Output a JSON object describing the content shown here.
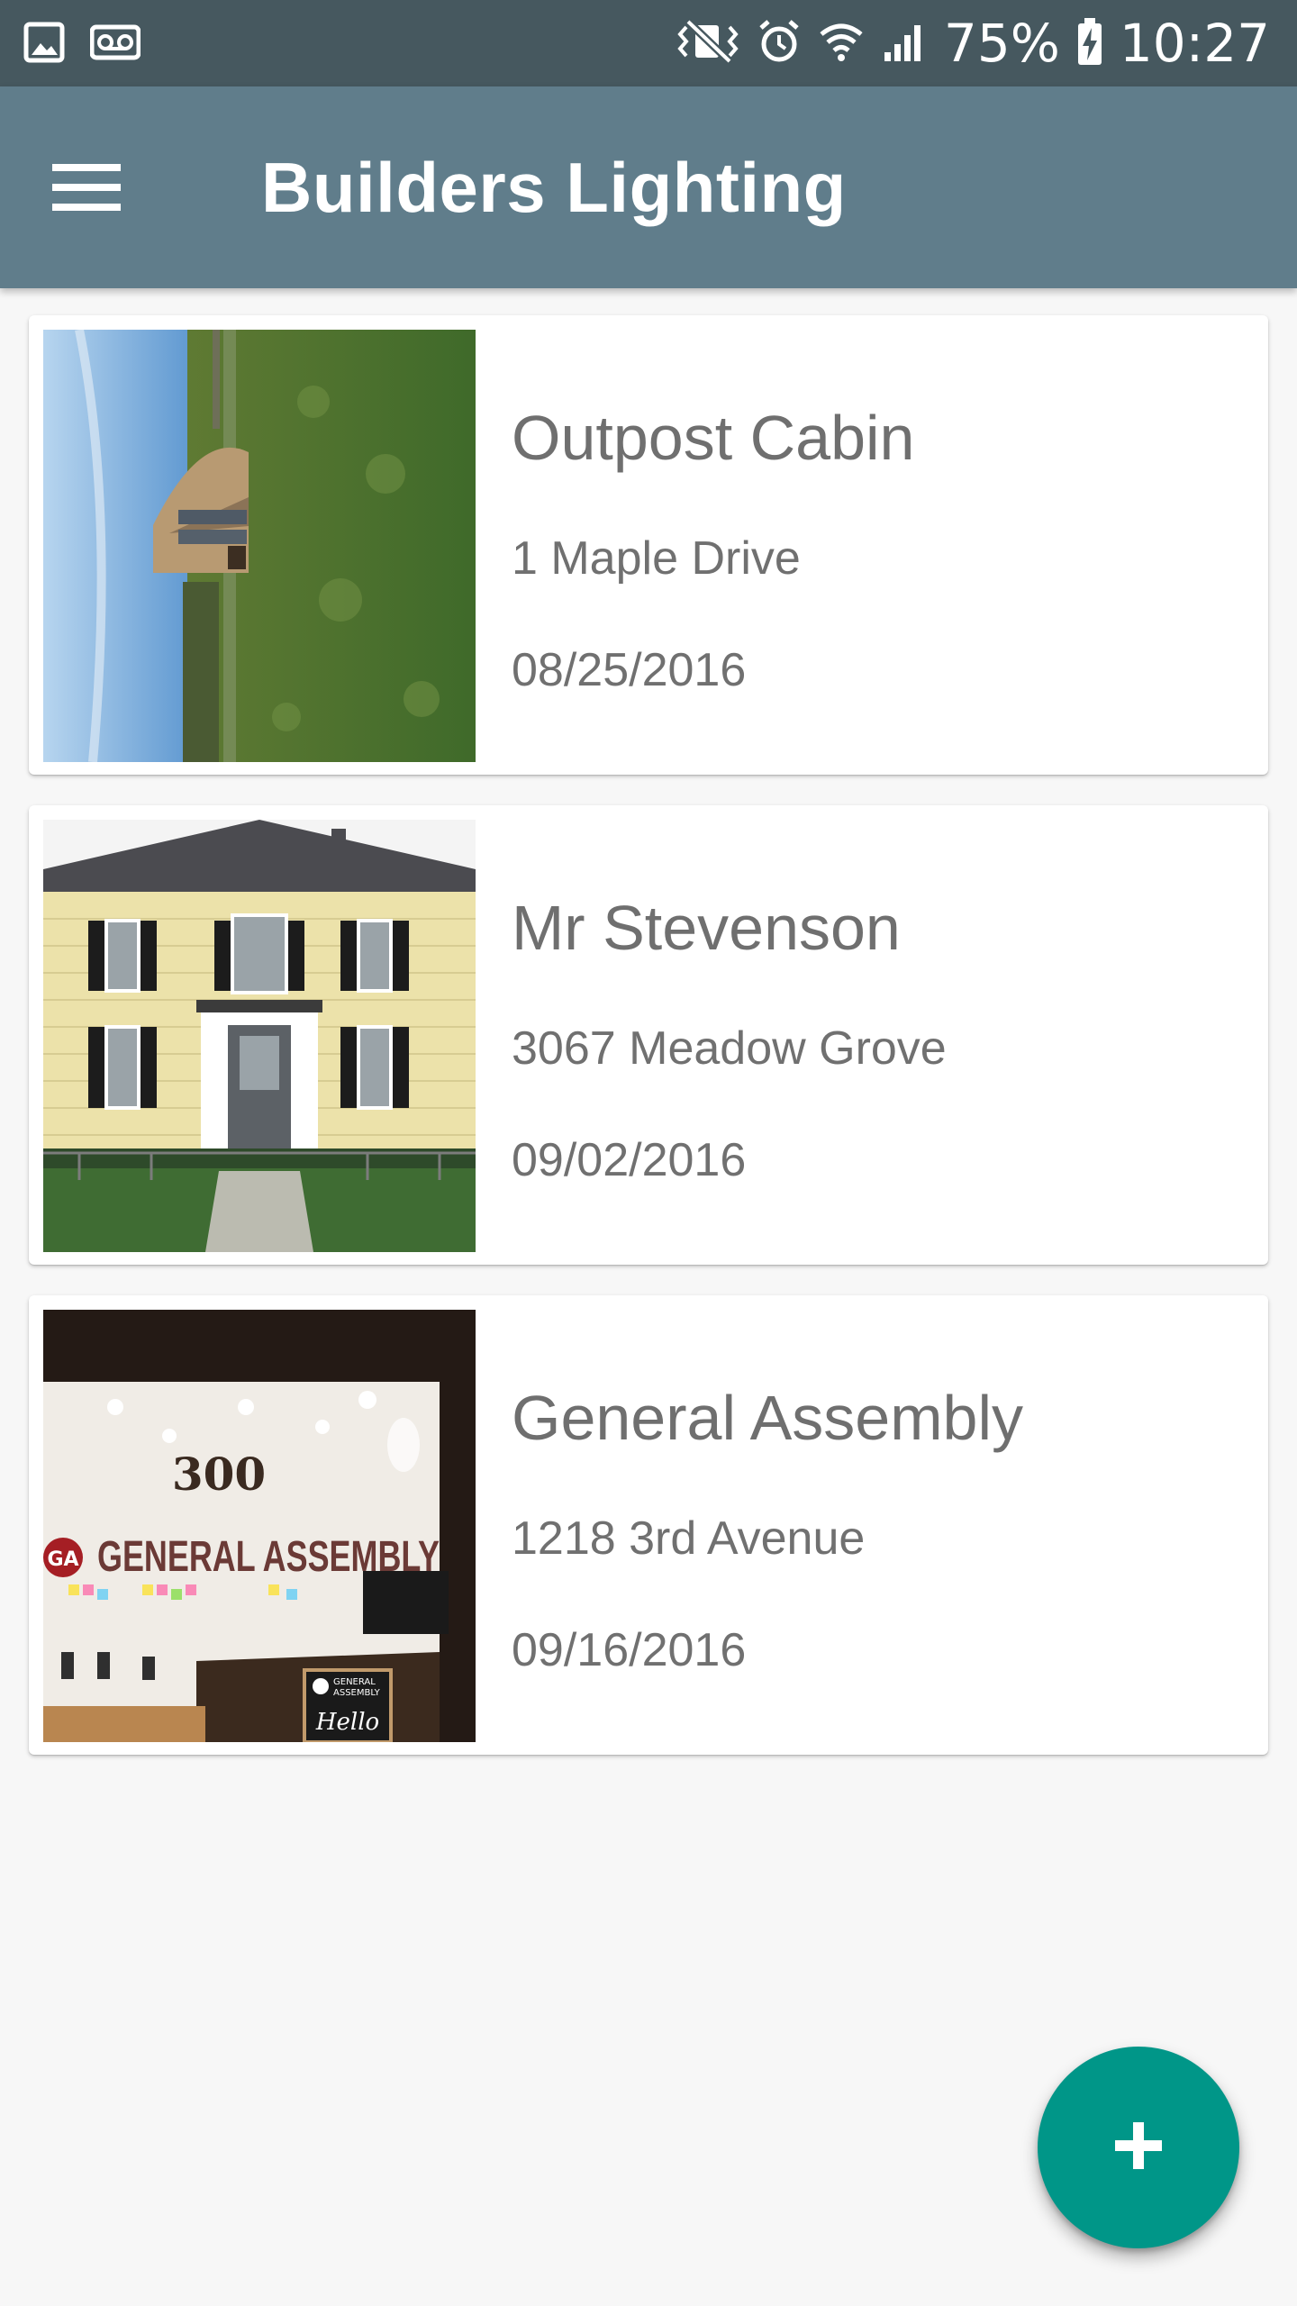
{
  "status_bar": {
    "icons_left": [
      "gallery-icon",
      "voicemail-icon"
    ],
    "icons_right": [
      "vibrate-icon",
      "alarm-icon",
      "wifi-icon",
      "signal-icon"
    ],
    "battery": "75%",
    "battery_icon": "battery-charging-icon",
    "time": "10:27"
  },
  "app_bar": {
    "menu_icon": "hamburger-menu-icon",
    "title": "Builders Lighting",
    "color": "#607d8b"
  },
  "projects": [
    {
      "title": "Outpost Cabin",
      "address": "1 Maple Drive",
      "date": "08/25/2016",
      "photo": "cabin-field-photo"
    },
    {
      "title": "Mr Stevenson",
      "address": "3067 Meadow Grove",
      "date": "09/02/2016",
      "photo": "yellow-house-photo"
    },
    {
      "title": "General Assembly",
      "address": "1218 3rd Avenue",
      "date": "09/16/2016",
      "photo": "office-lobby-photo",
      "photo_text": {
        "number": "300",
        "logo": "GA",
        "sign": "GENERAL ASSEMBLY",
        "board_line1": "GENERAL",
        "board_line2": "ASSEMBLY",
        "board_script": "Hello"
      }
    }
  ],
  "fab": {
    "icon": "add-icon",
    "label": "+",
    "color": "#009688"
  }
}
